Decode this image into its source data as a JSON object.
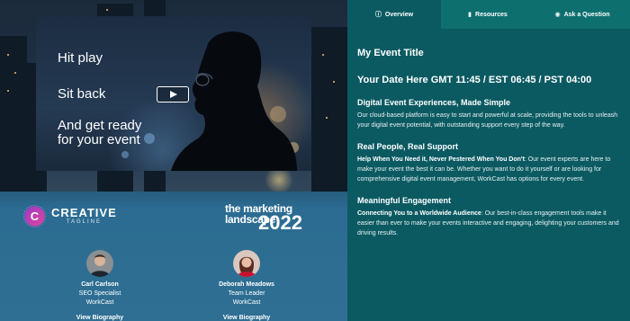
{
  "video": {
    "line1": "Hit play",
    "line2": "Sit back",
    "line3a": "And get ready",
    "line3b": "for your event"
  },
  "logos": {
    "creative_name": "CREATIVE",
    "creative_tagline": "TAGLINE",
    "landscape_line1": "the marketing",
    "landscape_line2": "landscape",
    "landscape_year": "2022"
  },
  "speakers": [
    {
      "name": "Carl Carlson",
      "title": "SEO Specialist",
      "company": "WorkCast",
      "link": "View Biography"
    },
    {
      "name": "Deborah Meadows",
      "title": "Team Leader",
      "company": "WorkCast",
      "link": "View Biography"
    }
  ],
  "tabs": [
    {
      "label": "Overview",
      "icon": "info-icon"
    },
    {
      "label": "Resources",
      "icon": "folder-icon"
    },
    {
      "label": "Ask a Question",
      "icon": "chat-icon"
    }
  ],
  "event": {
    "title": "My Event Title",
    "date": "Your Date Here GMT 11:45 / EST 06:45 / PST 04:00",
    "sections": [
      {
        "heading": "Digital Event Experiences, Made Simple",
        "lead": "",
        "body": "Our cloud-based platform is easy to start and powerful at scale, providing the tools to unleash your digital event potential, with outstanding support every step of the way."
      },
      {
        "heading": "Real People, Real Support",
        "lead": "Help When You Need it, Never Pestered When You Don't",
        "body": ": Our event experts are here to make your event the best it can be. Whether you want to do it yourself or are looking for comprehensive digital event management, WorkCast has options for every event."
      },
      {
        "heading": "Meaningful Engagement",
        "lead": "Connecting You to a Worldwide Audience",
        "body": ": Our best-in-class engagement tools make it easier than ever to make your events interactive and engaging, delighting your customers and driving results."
      }
    ]
  },
  "colors": {
    "panel": "#0b5a62",
    "tab_inactive": "#0e6f6f",
    "left_bottom": "#2e6f93"
  }
}
